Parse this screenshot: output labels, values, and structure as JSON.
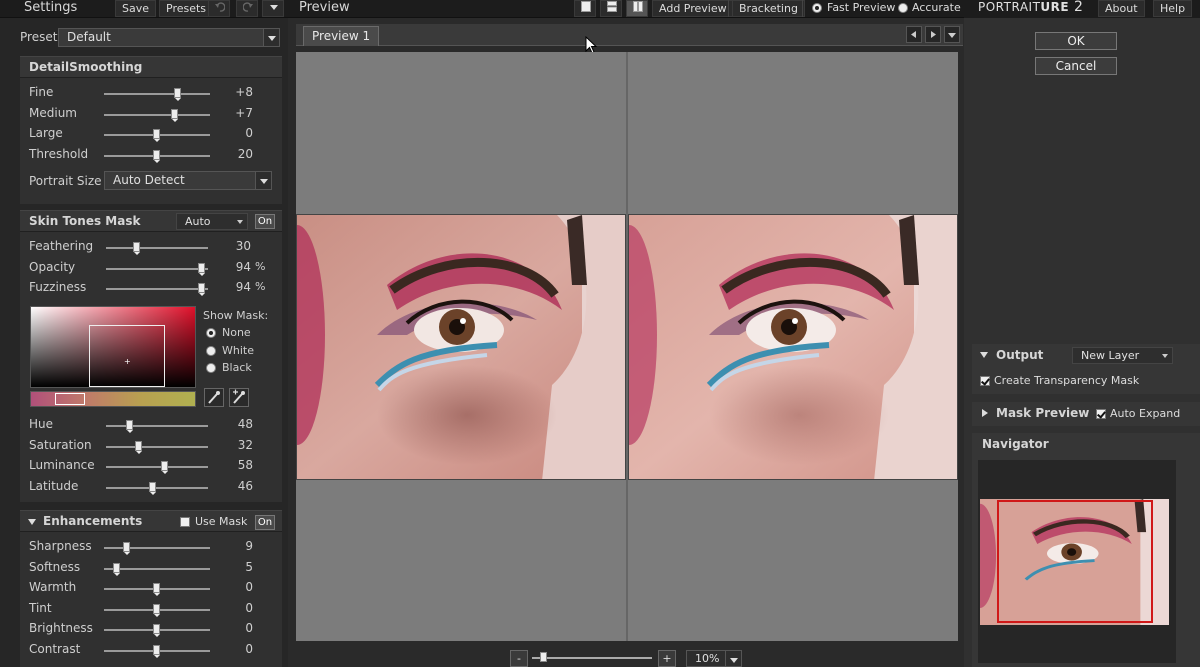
{
  "left_toolbar": {
    "title": "Settings",
    "save": "Save",
    "presets": "Presets"
  },
  "preset": {
    "label": "Preset",
    "value": "Default"
  },
  "detail_smoothing": {
    "title": "DetailSmoothing",
    "sliders": [
      {
        "label": "Fine",
        "value": "+8",
        "level": 0.7
      },
      {
        "label": "Medium",
        "value": "+7",
        "level": 0.67
      },
      {
        "label": "Large",
        "value": "0",
        "level": 0.5
      },
      {
        "label": "Threshold",
        "value": "20",
        "level": 0.5
      }
    ],
    "portrait_size_label": "Portrait Size",
    "portrait_size_value": "Auto Detect"
  },
  "skin_tones_mask": {
    "title": "Skin Tones Mask",
    "mode": "Auto",
    "on_label": "On",
    "sliders": [
      {
        "label": "Feathering",
        "value": "30",
        "unit": "",
        "level": 0.3
      },
      {
        "label": "Opacity",
        "value": "94",
        "unit": "%",
        "level": 0.94
      },
      {
        "label": "Fuzziness",
        "value": "94",
        "unit": "%",
        "level": 0.94
      }
    ],
    "show_mask_label": "Show Mask:",
    "show_mask_options": [
      "None",
      "White",
      "Black"
    ],
    "show_mask_selected": "None",
    "color_sliders": [
      {
        "label": "Hue",
        "value": "48",
        "level": 0.24
      },
      {
        "label": "Saturation",
        "value": "32",
        "level": 0.32
      },
      {
        "label": "Luminance",
        "value": "58",
        "level": 0.58
      },
      {
        "label": "Latitude",
        "value": "46",
        "level": 0.46
      }
    ]
  },
  "enhancements": {
    "title": "Enhancements",
    "use_mask_label": "Use Mask",
    "use_mask_checked": false,
    "on_label": "On",
    "sliders": [
      {
        "label": "Sharpness",
        "value": "9",
        "level": 0.22
      },
      {
        "label": "Softness",
        "value": "5",
        "level": 0.12
      },
      {
        "label": "Warmth",
        "value": "0",
        "level": 0.5
      },
      {
        "label": "Tint",
        "value": "0",
        "level": 0.5
      },
      {
        "label": "Brightness",
        "value": "0",
        "level": 0.5
      },
      {
        "label": "Contrast",
        "value": "0",
        "level": 0.5
      }
    ]
  },
  "center_toolbar": {
    "title": "Preview",
    "add_preview": "Add Preview",
    "bracketing": "Bracketing",
    "fast_preview": "Fast Preview",
    "accurate": "Accurate",
    "selected_quality": "Fast Preview"
  },
  "preview_tab": "Preview 1",
  "zoom": {
    "minus": "-",
    "plus": "+",
    "value": "10%",
    "level": 0.1
  },
  "right_header": {
    "brand_a": "PORTRAIT",
    "brand_b": "URE",
    "brand_version": " 2",
    "about": "About",
    "help": "Help"
  },
  "dialog": {
    "ok": "OK",
    "cancel": "Cancel"
  },
  "output": {
    "title": "Output",
    "value": "New Layer",
    "create_mask_label": "Create Transparency Mask",
    "create_mask_checked": true
  },
  "mask_preview": {
    "title": "Mask Preview",
    "auto_expand_label": "Auto Expand",
    "auto_expand_checked": true
  },
  "navigator": {
    "title": "Navigator"
  },
  "colors": {
    "panel": "#303030",
    "canvas": "#7c7c7c",
    "navigator_frame": "#d01818"
  },
  "icons": [
    "undo-icon",
    "redo-icon",
    "menu-arrow-icon",
    "single-view-icon",
    "split-horizontal-icon",
    "split-vertical-icon",
    "eyedropper-icon",
    "eyedropper-plus-icon",
    "cursor-icon"
  ]
}
